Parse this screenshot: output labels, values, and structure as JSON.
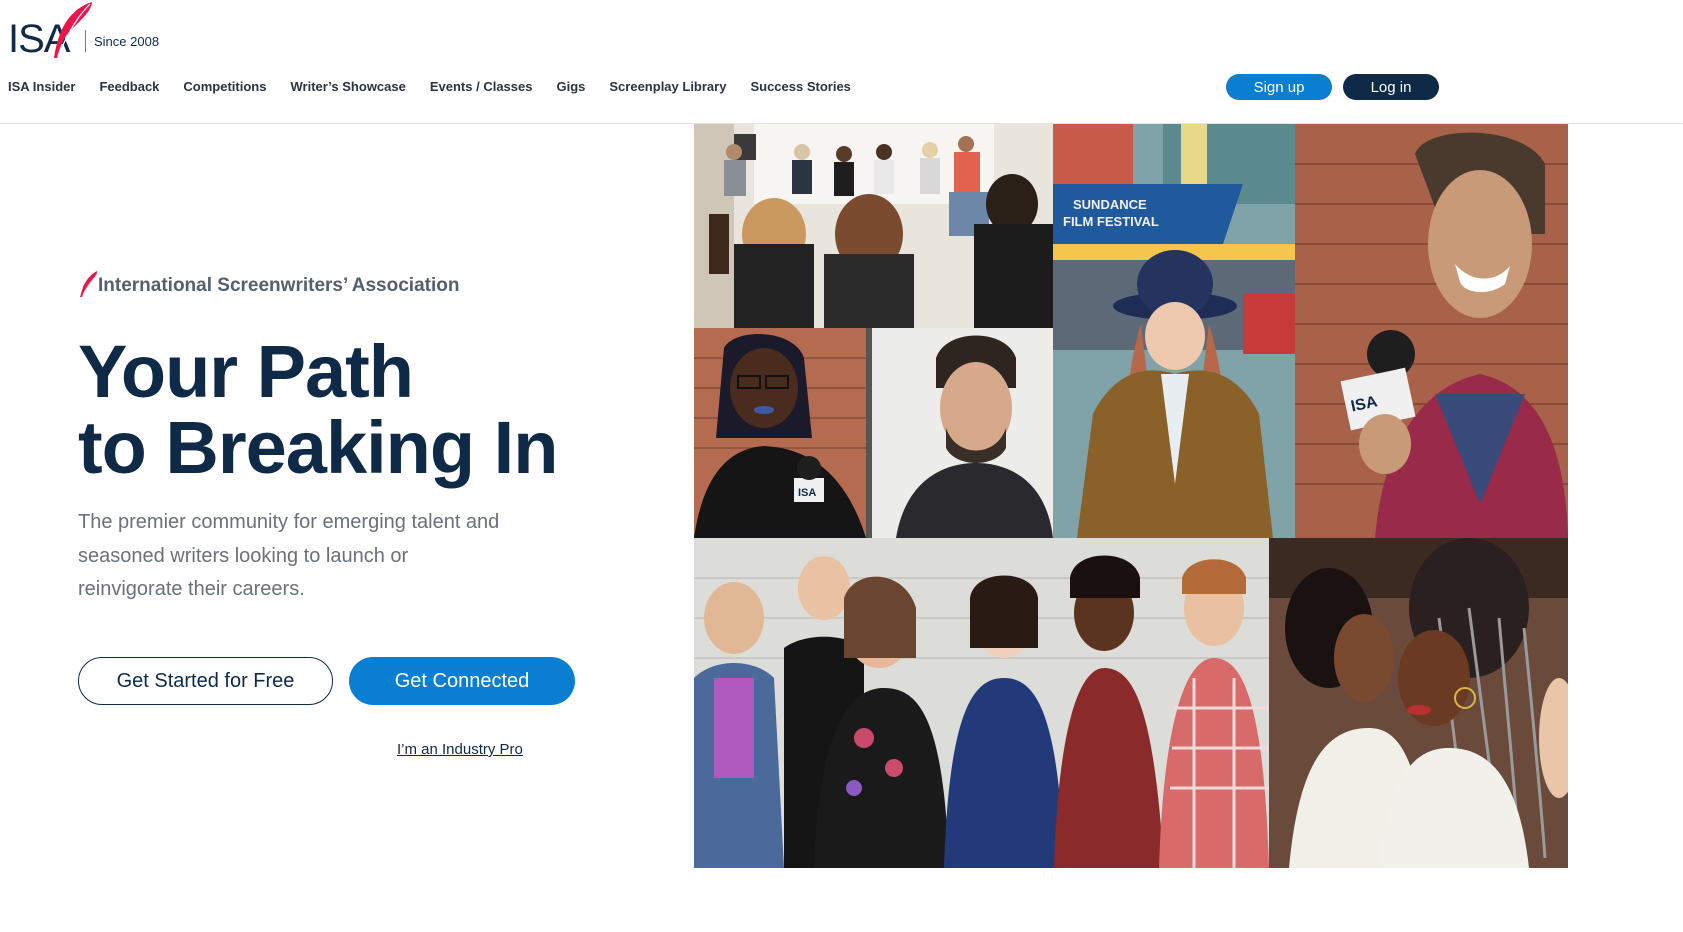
{
  "brand": {
    "logo_text": "ISA",
    "since": "Since 2008",
    "accent_color": "#e8174a",
    "navy": "#0e2a47",
    "blue": "#0a7ed0"
  },
  "nav": {
    "items": [
      {
        "label": "ISA Insider"
      },
      {
        "label": "Feedback"
      },
      {
        "label": "Competitions"
      },
      {
        "label": "Writer’s Showcase"
      },
      {
        "label": "Events / Classes"
      },
      {
        "label": "Gigs"
      },
      {
        "label": "Screenplay Library"
      },
      {
        "label": "Success Stories"
      }
    ],
    "signup_label": "Sign up",
    "login_label": "Log in"
  },
  "hero": {
    "org_name": "International Screenwriters’ Association",
    "headline_line1": "Your Path",
    "headline_line2": "to Breaking In",
    "subtext": "The premier community for emerging talent and seasoned writers looking to launch or reinvigorate their careers.",
    "cta_primary": "Get Started for Free",
    "cta_secondary": "Get Connected",
    "pro_link": "I’m an Industry Pro"
  },
  "collage": {
    "photos": [
      {
        "name": "panel-discussion-photo"
      },
      {
        "name": "sundance-festival-photo",
        "marquee_text_1": "SUNDANCE",
        "marquee_text_2": "FILM FESTIVAL"
      },
      {
        "name": "interviewee-microphone-photo",
        "mic_label": "ISA"
      },
      {
        "name": "writer-with-microphone-photo",
        "mic_label": "ISA"
      },
      {
        "name": "smiling-man-photo"
      },
      {
        "name": "group-of-writers-photo"
      },
      {
        "name": "audience-women-photo"
      }
    ]
  }
}
